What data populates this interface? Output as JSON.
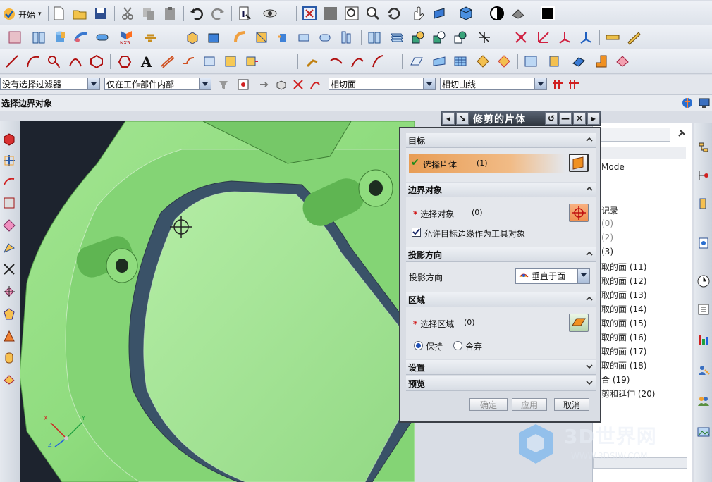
{
  "toolbar": {
    "start_label": "开始",
    "start_arrow": "▾",
    "row1_icons": [
      "new-icon",
      "open-icon",
      "save-icon",
      "cut-icon",
      "copy-icon",
      "paste-icon",
      "undo-icon",
      "redo-icon",
      "info-icon",
      "view-icon",
      "fit-icon",
      "zoom-icon",
      "zoom-window-icon",
      "zoom-in-icon",
      "rotate-icon",
      "pan-icon",
      "perspective-icon",
      "shaded-cube-icon",
      "display-mode-icon",
      "material-icon",
      "color-swatch-icon"
    ],
    "row2_icons": [
      "book-icon",
      "cylinder-icon",
      "sweep-icon",
      "pipe-icon",
      "nx5-icon",
      "layer-icon",
      "box-icon",
      "block-icon",
      "blend-icon",
      "cut-block-icon",
      "extrude-icon",
      "revolve-icon",
      "book2-icon",
      "pattern-icon",
      "boolean-unite-icon",
      "boolean-subtract-icon",
      "boolean-intersect-icon",
      "trim-icon",
      "datum-icon",
      "axis-icon",
      "csys-icon",
      "ruler-icon",
      "measure-icon"
    ],
    "row3_icons": [
      "line-icon",
      "arc-icon",
      "spline-icon",
      "point-icon",
      "polygon-icon",
      "shape-icon",
      "text-icon",
      "offset-curve-icon",
      "bridge-icon",
      "project-curve-icon",
      "intersect-curve-icon",
      "edit-curve-icon",
      "curve-ops-icon",
      "surface-icon",
      "face-icon",
      "mesh-icon",
      "sew-icon",
      "patch-icon",
      "sheet-icon",
      "swept-surface-icon",
      "thicken-icon",
      "shell-icon"
    ],
    "nx5_label": "NX5"
  },
  "filter_bar": {
    "type_filter": "没有选择过滤器",
    "scope_filter": "仅在工作部件内部",
    "face_rule": "相切面",
    "curve_rule": "相切曲线"
  },
  "cue_line": "选择边界对象",
  "left_toolbar_icons": [
    "cube-icon",
    "trim-body-icon",
    "surface-icon",
    "face-icon",
    "blend-icon",
    "edge-icon",
    "axis-cross-icon",
    "move-icon",
    "shape-icon",
    "cone-icon",
    "sheet-icon",
    "cylinder-icon",
    "offset-icon"
  ],
  "navigator": {
    "partial_title": "Mode",
    "rows": [
      "Mode",
      "记录",
      "(0)",
      "(2)",
      "(3)",
      "取的面 (11)",
      "取的面 (12)",
      "取的面 (13)",
      "取的面 (14)",
      "取的面 (15)",
      "取的面 (16)",
      "取的面 (17)",
      "取的面 (18)",
      "合 (19)",
      "剪和延伸 (20)"
    ]
  },
  "right_toolbar_icons": [
    "assembly-icon",
    "constraint-icon",
    "part-icon",
    "history-icon",
    "clock-icon",
    "list-icon",
    "palette-icon",
    "roles-icon",
    "users-icon",
    "image-icon"
  ],
  "dialog": {
    "title": "修剪的片体",
    "title_buttons": [
      "arrow-left-icon",
      "pin-icon",
      "reset-icon",
      "minimize-icon",
      "close-icon",
      "arrow-right-icon"
    ],
    "sections": {
      "target": {
        "header": "目标",
        "select_label": "选择片体",
        "count": "(1)",
        "status_icon": "checkmark-icon"
      },
      "boundary": {
        "header": "边界对象",
        "select_label": "选择对象",
        "count": "(0)",
        "checkbox_label": "允许目标边缘作为工具对象",
        "checkbox_checked": true
      },
      "projection": {
        "header": "投影方向",
        "label": "投影方向",
        "value": "垂直于面"
      },
      "region": {
        "header": "区域",
        "select_label": "选择区域",
        "count": "(0)",
        "keep_label": "保持",
        "discard_label": "舍弃",
        "selected": "keep"
      },
      "settings": {
        "header": "设置"
      },
      "preview": {
        "header": "预览"
      }
    },
    "buttons": {
      "ok": "确定",
      "apply": "应用",
      "cancel": "取消"
    }
  },
  "watermark": {
    "text": "3D世界网",
    "url": "WWW.3DSJW.COM"
  },
  "colors": {
    "model_green": "#8fdc7e",
    "viewport_bg": "#1e2430",
    "dialog_title": "#2d333c",
    "selected_bar": "#e8a05a"
  }
}
